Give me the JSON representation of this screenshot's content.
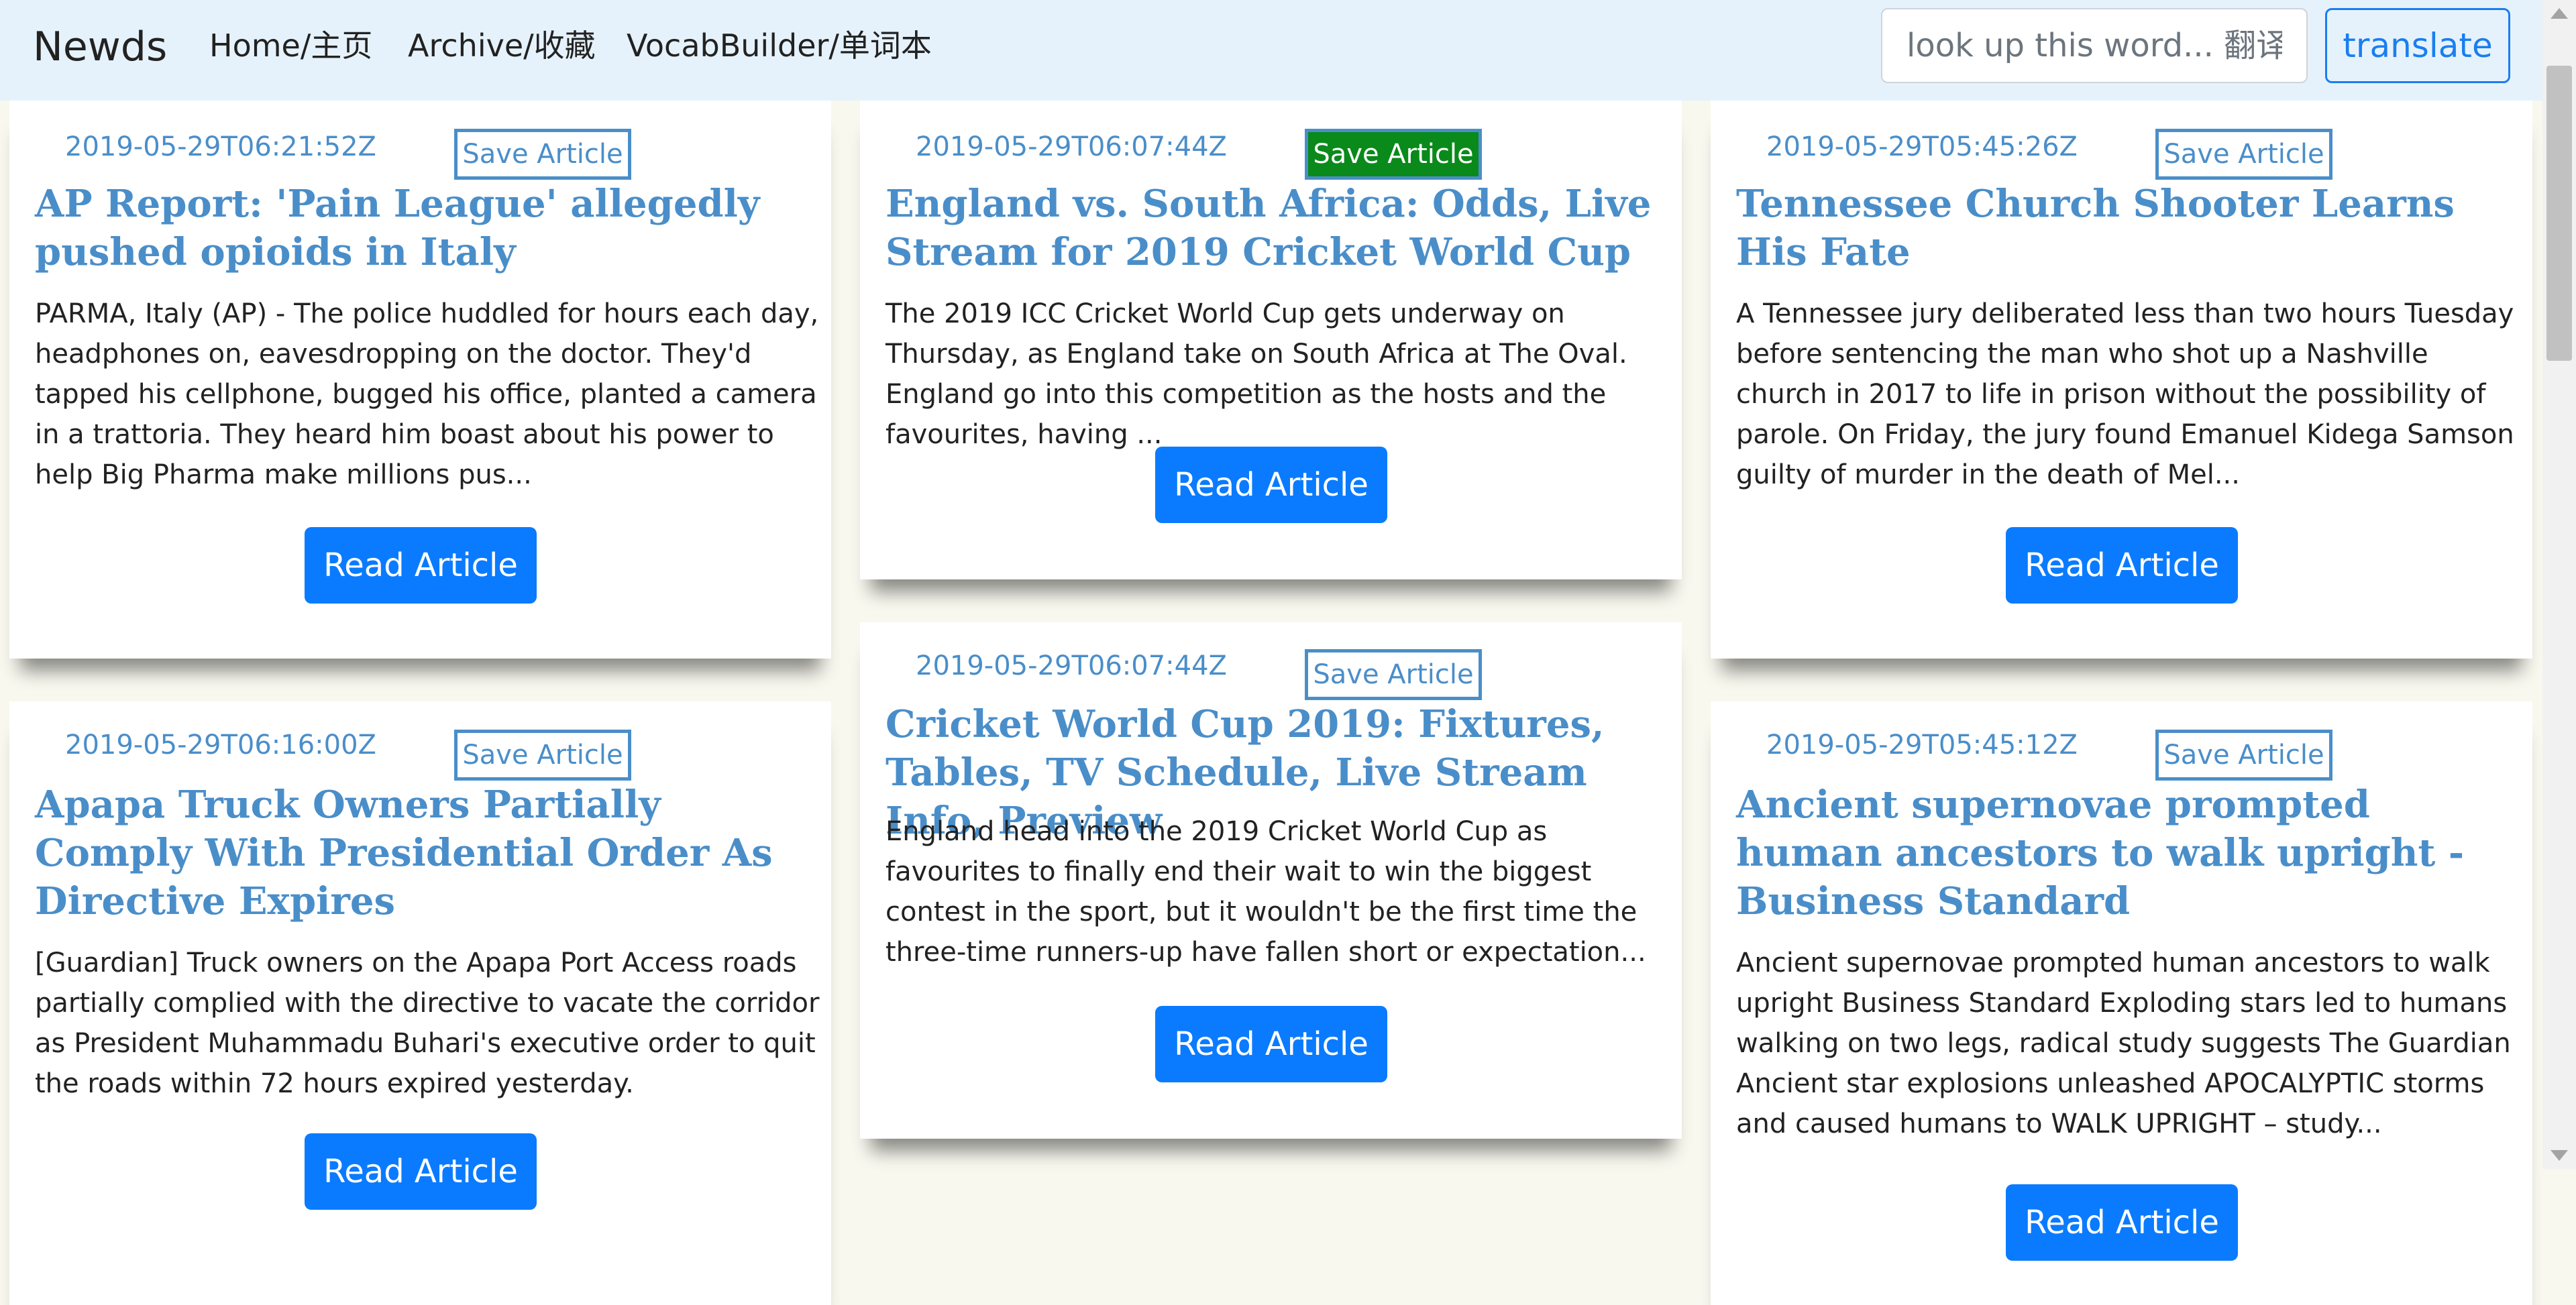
{
  "nav": {
    "brand": "Newds",
    "home": "Home/主页",
    "archive": "Archive/收藏",
    "vocab": "VocabBuilder/单词本",
    "search_placeholder": "look up this word... 翻译",
    "translate_label": "translate"
  },
  "articles": [
    {
      "date": "2019-05-29T06:21:52Z",
      "save_label": "Save Article",
      "saved": false,
      "title": "AP Report: 'Pain League' allegedly pushed opioids in Italy",
      "description": "PARMA, Italy (AP) - The police huddled for hours each day, headphones on, eavesdropping on the doctor. They'd tapped his cellphone, bugged his office, planted a camera in a trattoria. They heard him boast about his power to help Big Pharma make millions pus...",
      "read_label": "Read Article"
    },
    {
      "date": "2019-05-29T06:07:44Z",
      "save_label": "Save Article",
      "saved": true,
      "title": "England vs. South Africa: Odds, Live Stream for 2019 Cricket World Cup",
      "description": "The 2019 ICC Cricket World Cup gets underway on Thursday, as England take on South Africa at The Oval. England go into this competition as the hosts and the favourites, having ...",
      "read_label": "Read Article"
    },
    {
      "date": "2019-05-29T05:45:26Z",
      "save_label": "Save Article",
      "saved": false,
      "title": "Tennessee Church Shooter Learns His Fate",
      "description": "A Tennessee jury deliberated less than two hours Tuesday before sentencing the man who shot up a Nashville church in 2017 to life in prison without the possibility of parole. On Friday, the jury found Emanuel Kidega Samson guilty of murder in the death of Mel...",
      "read_label": "Read Article"
    },
    {
      "date": "2019-05-29T06:16:00Z",
      "save_label": "Save Article",
      "saved": false,
      "title": "Apapa Truck Owners Partially Comply With Presidential Order As Directive Expires",
      "description": "[Guardian] Truck owners on the Apapa Port Access roads partially complied with the directive to vacate the corridor as President Muhammadu Buhari's executive order to quit the roads within 72 hours expired yesterday.",
      "read_label": "Read Article"
    },
    {
      "date": "2019-05-29T06:07:44Z",
      "save_label": "Save Article",
      "saved": false,
      "title": "Cricket World Cup 2019: Fixtures, Tables, TV Schedule, Live Stream Info, Preview",
      "description": "England head into the 2019 Cricket World Cup as favourites to finally end their wait to win the biggest contest in the sport, but it wouldn't be the first time the three-time runners-up have fallen short or expectation...",
      "read_label": "Read Article"
    },
    {
      "date": "2019-05-29T05:45:12Z",
      "save_label": "Save Article",
      "saved": false,
      "title": "Ancient supernovae prompted human ancestors to walk upright - Business Standard",
      "description": "Ancient supernovae prompted human ancestors to walk upright Business Standard Exploding stars led to humans walking on two legs, radical study suggests The Guardian Ancient star explosions unleashed APOCALYPTIC storms and caused humans to WALK UPRIGHT – study...",
      "read_label": "Read Article"
    }
  ],
  "colors": {
    "accent": "#4a8ec9",
    "primary_button": "#0a7bff",
    "saved_button": "#0a8a1a",
    "navbar_bg": "#e6f2fb",
    "page_bg": "#f8f8ef"
  }
}
